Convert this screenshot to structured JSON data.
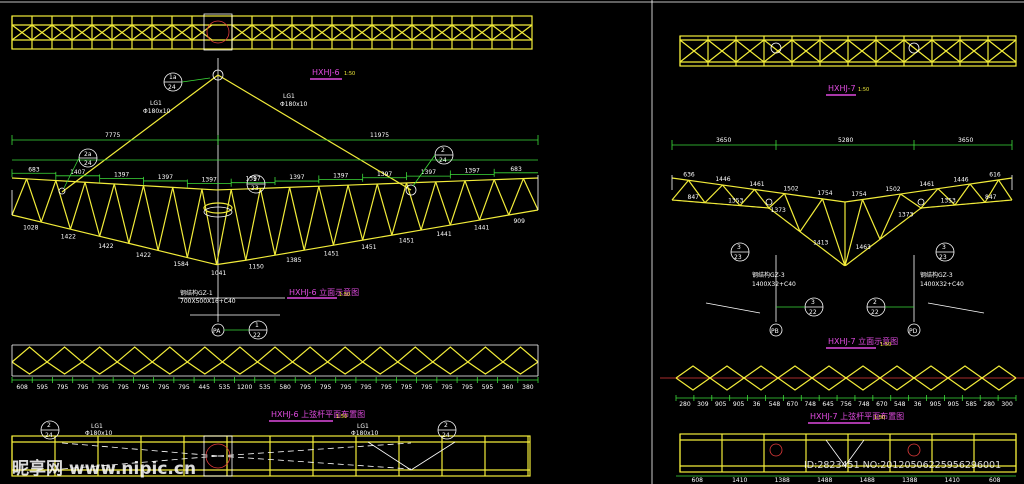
{
  "colors": {
    "background": "#000000",
    "member": "#f2ec3a",
    "dimension": "#3ddc3a",
    "text": "#ffffff",
    "title": "#e04be0",
    "axis": "#e23b3b"
  },
  "left": {
    "title": "HXHJ-6",
    "title_scale": "1:50",
    "section_title": "HXHJ-6 立面示意图",
    "section_scale": "1:50",
    "plan_title": "HXHJ-6 上弦杆平面布置图",
    "plan_scale": "1:50",
    "top_span_left": "7775",
    "top_span_right": "11975",
    "left_cable": "LG1",
    "left_cable_spec": "Φ180x10",
    "right_cable": "LG1",
    "right_cable_spec": "Φ180x10",
    "tags": {
      "top": {
        "a": "1a",
        "b": "24"
      },
      "left": {
        "a": "2a",
        "b": "24"
      },
      "right": {
        "a": "2",
        "b": "24"
      },
      "mid": {
        "a": "1",
        "b": "23"
      },
      "bottom": {
        "a": "1",
        "b": "22"
      }
    },
    "column_note": "钢结构GZ-1",
    "column_spec": "700X500X16+C40",
    "axis_label": "PA",
    "plan_tag_left": {
      "a": "2",
      "b": "24"
    },
    "plan_tag_right": {
      "a": "2",
      "b": "24"
    },
    "plan_cable_left": "LG1",
    "plan_cable_left_spec": "Φ180x10",
    "plan_cable_right": "LG1",
    "plan_cable_right_spec": "Φ180x10",
    "top_chord_dims": [
      "683",
      "1407",
      "1397",
      "1397",
      "1397",
      "1397",
      "1397",
      "1397",
      "1397",
      "1397",
      "1397",
      "683"
    ],
    "bottom_chord_dims": [
      "1028",
      "1422",
      "1422",
      "1422",
      "1584",
      "1041",
      "1150",
      "1385",
      "1451",
      "1451",
      "1451",
      "1441",
      "1441",
      "909"
    ],
    "bottom_dims": [
      "608",
      "595",
      "795",
      "795",
      "795",
      "795",
      "795",
      "795",
      "795",
      "445",
      "535",
      "1200",
      "535",
      "580",
      "795",
      "795",
      "795",
      "795",
      "795",
      "795",
      "795",
      "795",
      "795",
      "595",
      "360",
      "380"
    ]
  },
  "right": {
    "title": "HXHJ-7",
    "title_scale": "1:50",
    "section_title": "HXHJ-7 立面示意图",
    "section_scale": "1:50",
    "plan_title": "HXHJ-7 上弦杆平面布置图",
    "plan_scale": "1:50",
    "top_dims": [
      "3650",
      "5280",
      "3650"
    ],
    "tag_left": {
      "a": "3",
      "b": "23"
    },
    "tag_right": {
      "a": "3",
      "b": "23"
    },
    "tag_low_left": {
      "a": "3",
      "b": "22"
    },
    "tag_low_right": {
      "a": "2",
      "b": "22"
    },
    "column_left": "钢结构GZ-3",
    "column_left_spec": "1400X32+C40",
    "column_right": "钢结构GZ-3",
    "column_right_spec": "1400X32+C40",
    "axis_left": "PB",
    "axis_right": "PD",
    "top_chord_dims": [
      "636",
      "1446",
      "1461",
      "1502",
      "1754",
      "1754",
      "1502",
      "1461",
      "1446",
      "616"
    ],
    "bottom_chord_dims": [
      "847",
      "1353",
      "1373",
      "1413",
      "1463",
      "1373",
      "1353",
      "847"
    ],
    "bottom_dims": [
      "280",
      "309",
      "905",
      "905",
      "36",
      "548",
      "670",
      "748",
      "645",
      "756",
      "748",
      "670",
      "548",
      "36",
      "905",
      "905",
      "585",
      "280",
      "300"
    ],
    "plan_dims": [
      "608",
      "1410",
      "1388",
      "1488",
      "1488",
      "1388",
      "1410",
      "608"
    ]
  },
  "watermark": {
    "brand": "昵享网 www.nipic.cn",
    "id": "ID:2823451 NO:20120506225956296001"
  }
}
